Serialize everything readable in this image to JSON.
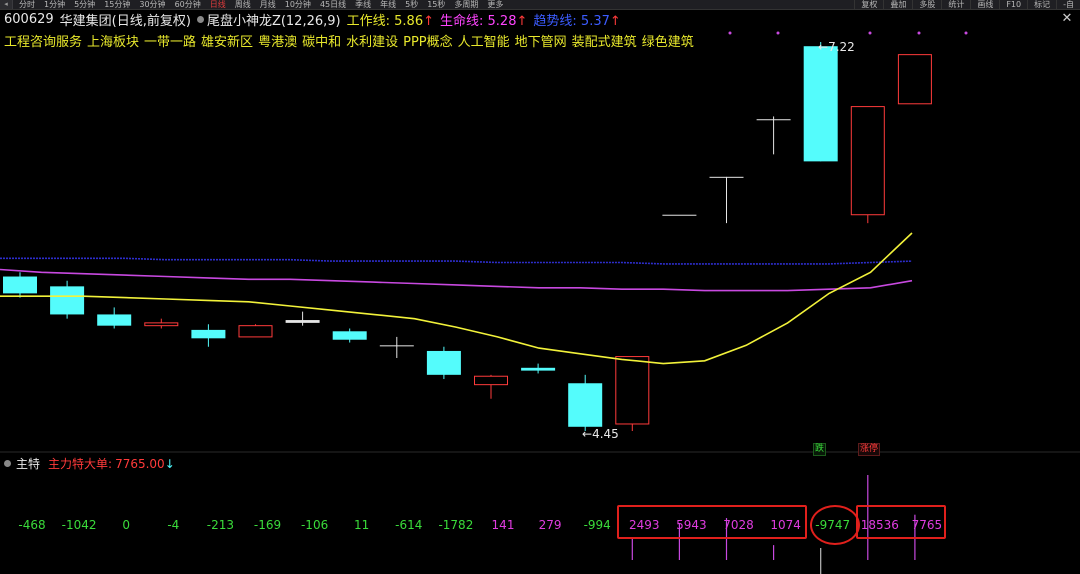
{
  "toolbar": {
    "items": [
      {
        "label": "分时",
        "active": false
      },
      {
        "label": "1分钟",
        "active": false
      },
      {
        "label": "5分钟",
        "active": false
      },
      {
        "label": "15分钟",
        "active": false
      },
      {
        "label": "30分钟",
        "active": false
      },
      {
        "label": "60分钟",
        "active": false
      },
      {
        "label": "日线",
        "active": true
      },
      {
        "label": "周线",
        "active": false
      },
      {
        "label": "月线",
        "active": false
      },
      {
        "label": "10分钟",
        "active": false
      },
      {
        "label": "45日线",
        "active": false
      },
      {
        "label": "季线",
        "active": false
      },
      {
        "label": "年线",
        "active": false
      },
      {
        "label": "5秒",
        "active": false
      },
      {
        "label": "15秒",
        "active": false
      },
      {
        "label": "多周期",
        "active": false
      },
      {
        "label": "更多",
        "active": false
      }
    ],
    "right_items": [
      "复权",
      "叠加",
      "多股",
      "统计",
      "画线",
      "F10",
      "标记",
      "-自"
    ]
  },
  "stock": {
    "code": "600629",
    "name": "华建集团",
    "mode": "(日线,前复权)",
    "indicator_name": "尾盘小神龙Z(12,26,9)",
    "work_line_label": "工作线:",
    "work_line_value": "5.86",
    "work_line_arrow": "↑",
    "life_line_label": "生命线:",
    "life_line_value": "5.28",
    "life_line_arrow": "↑",
    "trend_line_label": "趋势线:",
    "trend_line_value": "5.37",
    "trend_line_arrow": "↑"
  },
  "concepts": [
    "工程咨询服务",
    "上海板块",
    "一带一路",
    "雄安新区",
    "粤港澳",
    "碳中和",
    "水利建设",
    "PPP概念",
    "人工智能",
    "地下管网",
    "装配式建筑",
    "绿色建筑"
  ],
  "price_labels": {
    "high": "7.22",
    "low": "4.45"
  },
  "lower_panel": {
    "title": "主特",
    "indicator_label": "主力特大单:",
    "indicator_value": "7765.00",
    "indicator_arrow": "↓"
  },
  "tags": {
    "down": "跌",
    "limit_up": "涨停"
  },
  "chart_data": {
    "type": "candlestick",
    "candles": [
      {
        "open": 5.55,
        "close": 5.43,
        "high": 5.58,
        "low": 5.4,
        "color": "cyan"
      },
      {
        "open": 5.48,
        "close": 5.28,
        "high": 5.52,
        "low": 5.25,
        "color": "cyan"
      },
      {
        "open": 5.28,
        "close": 5.2,
        "high": 5.33,
        "low": 5.18,
        "color": "cyan"
      },
      {
        "open": 5.2,
        "close": 5.22,
        "high": 5.25,
        "low": 5.18,
        "color": "red"
      },
      {
        "open": 5.17,
        "close": 5.11,
        "high": 5.21,
        "low": 5.05,
        "color": "cyan"
      },
      {
        "open": 5.12,
        "close": 5.2,
        "high": 5.21,
        "low": 5.12,
        "color": "red"
      },
      {
        "open": 5.22,
        "close": 5.24,
        "high": 5.3,
        "low": 5.2,
        "color": "white"
      },
      {
        "open": 5.16,
        "close": 5.1,
        "high": 5.18,
        "low": 5.08,
        "color": "cyan"
      },
      {
        "open": 5.06,
        "close": 5.06,
        "high": 5.12,
        "low": 4.97,
        "color": "white"
      },
      {
        "open": 5.02,
        "close": 4.85,
        "high": 5.05,
        "low": 4.82,
        "color": "cyan"
      },
      {
        "open": 4.78,
        "close": 4.84,
        "high": 4.85,
        "low": 4.68,
        "color": "red"
      },
      {
        "open": 4.9,
        "close": 4.88,
        "high": 4.93,
        "low": 4.86,
        "color": "cyan"
      },
      {
        "open": 4.79,
        "close": 4.48,
        "high": 4.85,
        "low": 4.45,
        "color": "cyan"
      },
      {
        "open": 4.5,
        "close": 4.98,
        "high": 4.98,
        "low": 4.45,
        "color": "red"
      },
      {
        "open": 5.99,
        "close": 5.99,
        "high": 5.99,
        "low": 5.99,
        "color": "white"
      },
      {
        "open": 6.26,
        "close": 6.26,
        "high": 6.26,
        "low": 5.93,
        "color": "white"
      },
      {
        "open": 6.67,
        "close": 6.67,
        "high": 6.69,
        "low": 6.42,
        "color": "white"
      },
      {
        "open": 7.19,
        "close": 6.37,
        "high": 7.22,
        "low": 6.37,
        "color": "cyan"
      },
      {
        "open": 5.99,
        "close": 6.76,
        "high": 6.76,
        "low": 5.93,
        "color": "red"
      },
      {
        "open": 6.78,
        "close": 7.13,
        "high": 7.13,
        "low": 6.78,
        "color": "red"
      }
    ],
    "lines": {
      "work_line": [
        5.41,
        5.41,
        5.41,
        5.4,
        5.39,
        5.38,
        5.37,
        5.34,
        5.31,
        5.28,
        5.25,
        5.19,
        5.12,
        5.04,
        5.0,
        4.96,
        4.93,
        4.95,
        5.06,
        5.22,
        5.43,
        5.58,
        5.86
      ],
      "life_line": [
        5.6,
        5.58,
        5.57,
        5.56,
        5.55,
        5.54,
        5.53,
        5.53,
        5.52,
        5.51,
        5.5,
        5.49,
        5.48,
        5.47,
        5.47,
        5.46,
        5.46,
        5.45,
        5.45,
        5.45,
        5.46,
        5.47,
        5.52
      ],
      "trend_line": [
        5.68,
        5.68,
        5.68,
        5.68,
        5.67,
        5.67,
        5.67,
        5.67,
        5.66,
        5.66,
        5.66,
        5.66,
        5.65,
        5.65,
        5.65,
        5.65,
        5.64,
        5.64,
        5.64,
        5.64,
        5.64,
        5.65,
        5.66
      ]
    },
    "volume_values": [
      "-468",
      "-1042",
      "0",
      "-4",
      "-213",
      "-169",
      "-106",
      "11",
      "-614",
      "-1782",
      "141",
      "279",
      "-994",
      "2493",
      "5943",
      "7028",
      "1074",
      "-9747",
      "18536",
      "7765"
    ],
    "volume_colors": [
      "green",
      "green",
      "green",
      "green",
      "green",
      "green",
      "green",
      "green",
      "green",
      "green",
      "magenta",
      "magenta",
      "green",
      "magenta",
      "magenta",
      "magenta",
      "magenta",
      "green",
      "magenta",
      "magenta"
    ],
    "colors": {
      "cyan": "#54fcfc",
      "red": "#ff3b3b",
      "white": "#e6e6e6",
      "yellow": "#f2f23a",
      "magenta": "#c849e0",
      "blue": "#2d2dcc"
    }
  }
}
